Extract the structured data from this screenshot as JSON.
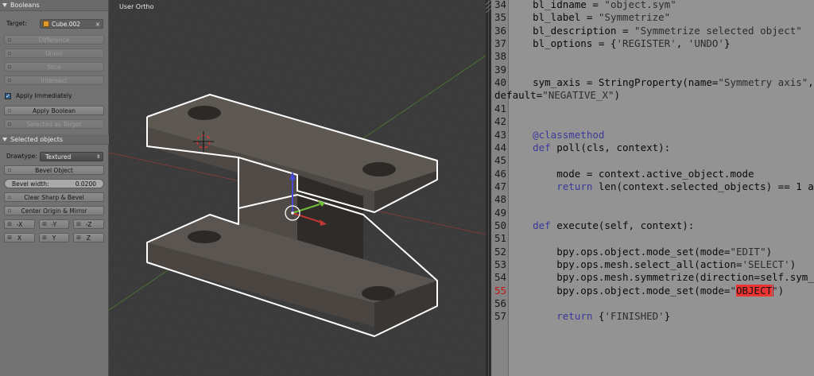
{
  "booleans": {
    "header": "Booleans",
    "target_label": "Target:",
    "target_value": "Cube.002",
    "difference": "Difference",
    "union": "Union",
    "slice": "Slice",
    "intersect": "Intersect",
    "apply_immediately": "Apply Immediately",
    "apply_boolean": "Apply Boolean",
    "selected_as_target": "Selected as Target"
  },
  "selected_objects": {
    "header": "Selected objects",
    "drawtype_label": "Drawtype:",
    "drawtype_value": "Textured",
    "bevel_object": "Bevel Object",
    "bevel_width_label": "Bevel width:",
    "bevel_width_value": "0.0200",
    "clear_sharp": "Clear Sharp & Bevel",
    "center_origin": "Center Origin & Mirror",
    "axis_row1": [
      "-X",
      "-Y",
      "-Z"
    ],
    "axis_row2": [
      "X",
      "Y",
      "Z"
    ]
  },
  "viewport": {
    "title": "User Ortho"
  },
  "editor": {
    "lines": [
      {
        "num": "34",
        "parts": [
          {
            "t": "    bl_idname = ",
            "c": ""
          },
          {
            "t": "\"object.sym\"",
            "c": "str"
          }
        ]
      },
      {
        "num": "35",
        "parts": [
          {
            "t": "    bl_label = ",
            "c": ""
          },
          {
            "t": "\"Symmetrize\"",
            "c": "str"
          }
        ]
      },
      {
        "num": "36",
        "parts": [
          {
            "t": "    bl_description = ",
            "c": ""
          },
          {
            "t": "\"Symmetrize selected object\"",
            "c": "str"
          }
        ]
      },
      {
        "num": "37",
        "parts": [
          {
            "t": "    bl_options = {",
            "c": ""
          },
          {
            "t": "'REGISTER'",
            "c": "str"
          },
          {
            "t": ", ",
            "c": ""
          },
          {
            "t": "'UNDO'",
            "c": "str"
          },
          {
            "t": "}",
            "c": ""
          }
        ]
      },
      {
        "num": "38",
        "parts": []
      },
      {
        "num": "39",
        "parts": []
      },
      {
        "num": "40",
        "parts": [
          {
            "t": "    sym_axis = StringProperty(name=",
            "c": ""
          },
          {
            "t": "\"Symmetry axis\"",
            "c": "str"
          },
          {
            "t": ",",
            "c": ""
          }
        ]
      },
      {
        "num": "",
        "parts": [
          {
            "t": "default=",
            "c": ""
          },
          {
            "t": "\"NEGATIVE_X\"",
            "c": "str"
          },
          {
            "t": ")",
            "c": ""
          }
        ]
      },
      {
        "num": "41",
        "parts": []
      },
      {
        "num": "42",
        "parts": []
      },
      {
        "num": "43",
        "parts": [
          {
            "t": "    @classmethod",
            "c": "dec"
          }
        ]
      },
      {
        "num": "44",
        "parts": [
          {
            "t": "    ",
            "c": ""
          },
          {
            "t": "def",
            "c": "kw"
          },
          {
            "t": " poll(cls, context):",
            "c": ""
          }
        ]
      },
      {
        "num": "45",
        "parts": []
      },
      {
        "num": "46",
        "parts": [
          {
            "t": "        mode = context.active_object.mode",
            "c": ""
          }
        ]
      },
      {
        "num": "47",
        "parts": [
          {
            "t": "        ",
            "c": ""
          },
          {
            "t": "return",
            "c": "kw"
          },
          {
            "t": " len(context.selected_objects) == 1 a",
            "c": ""
          }
        ]
      },
      {
        "num": "48",
        "parts": []
      },
      {
        "num": "49",
        "parts": []
      },
      {
        "num": "50",
        "parts": [
          {
            "t": "    ",
            "c": ""
          },
          {
            "t": "def",
            "c": "kw"
          },
          {
            "t": " execute(self, context):",
            "c": ""
          }
        ]
      },
      {
        "num": "51",
        "parts": []
      },
      {
        "num": "52",
        "parts": [
          {
            "t": "        bpy.ops.object.mode_set(mode=",
            "c": ""
          },
          {
            "t": "\"EDIT\"",
            "c": "str"
          },
          {
            "t": ")",
            "c": ""
          }
        ]
      },
      {
        "num": "53",
        "parts": [
          {
            "t": "        bpy.ops.mesh.select_all(action=",
            "c": ""
          },
          {
            "t": "'SELECT'",
            "c": "str"
          },
          {
            "t": ")",
            "c": ""
          }
        ]
      },
      {
        "num": "54",
        "parts": [
          {
            "t": "        bpy.ops.mesh.symmetrize(direction=self.sym_",
            "c": ""
          }
        ]
      },
      {
        "num": "55",
        "err": true,
        "parts": [
          {
            "t": "        bpy.ops.object.mode_set(mode=",
            "c": ""
          },
          {
            "t": "\"",
            "c": "str"
          },
          {
            "t": "OBJECT",
            "c": "sel"
          },
          {
            "t": "\"",
            "c": "str"
          },
          {
            "t": ")",
            "c": ""
          }
        ]
      },
      {
        "num": "56",
        "parts": []
      },
      {
        "num": "57",
        "parts": [
          {
            "t": "        ",
            "c": ""
          },
          {
            "t": "return",
            "c": "kw"
          },
          {
            "t": " {",
            "c": ""
          },
          {
            "t": "'FINISHED'",
            "c": "str"
          },
          {
            "t": "}",
            "c": ""
          }
        ]
      }
    ]
  },
  "colors": {
    "selection_outline": "#ffffff",
    "axis_x": "#c03535",
    "axis_y": "#6fbf3a",
    "axis_z": "#4848d0",
    "grid": "#424242"
  }
}
